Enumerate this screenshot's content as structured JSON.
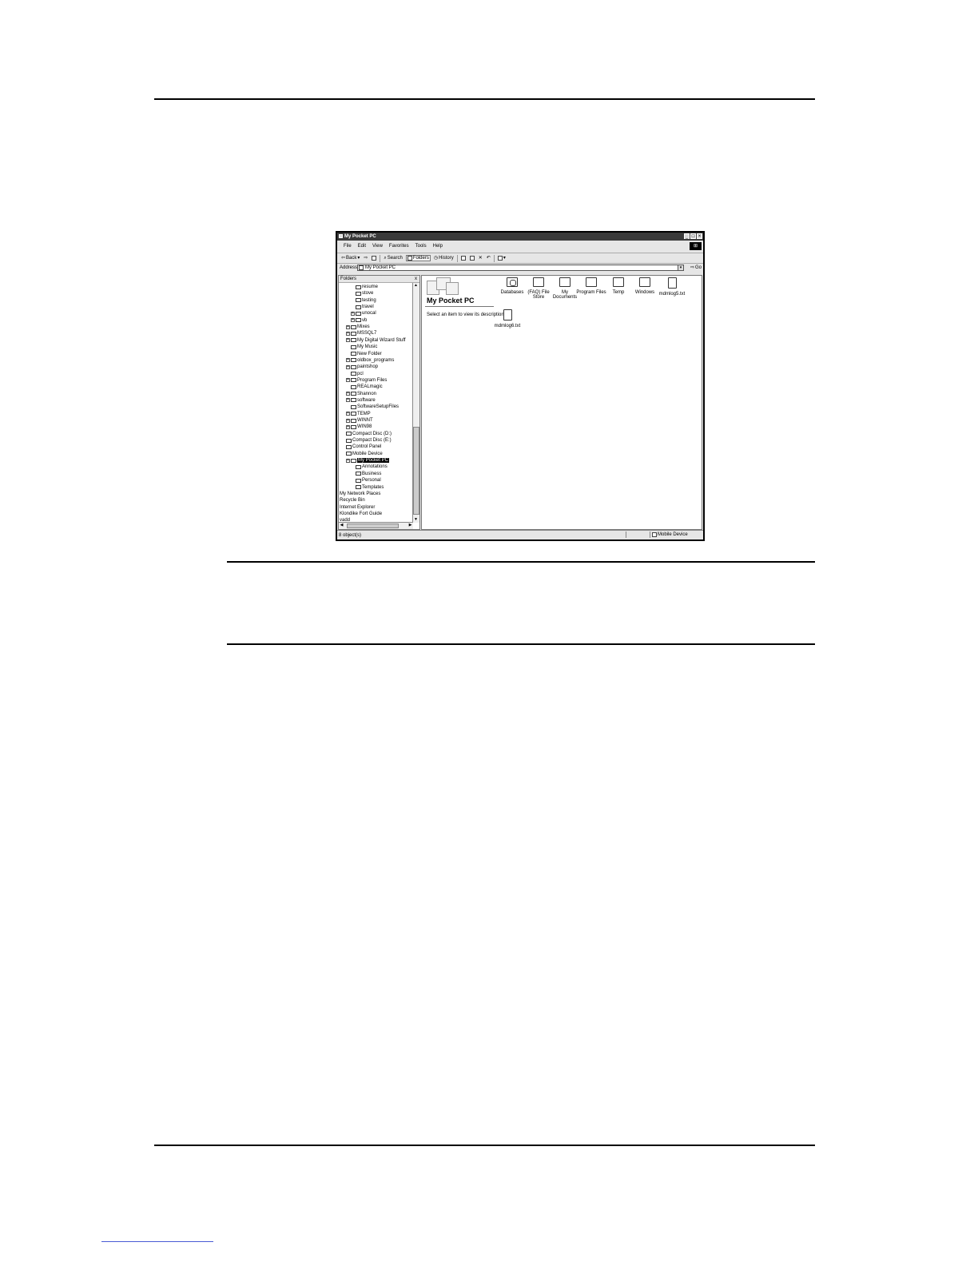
{
  "window": {
    "title": "My Pocket PC",
    "menu": [
      "File",
      "Edit",
      "View",
      "Favorites",
      "Tools",
      "Help"
    ],
    "toolbar": {
      "back": "Back",
      "search": "Search",
      "folders": "Folders",
      "history": "History"
    },
    "address": {
      "label": "Address",
      "value": "My Pocket PC",
      "go": "Go"
    },
    "folders_pane": {
      "title": "Folders",
      "close": "x",
      "tree": [
        {
          "label": "resume",
          "indent": 2,
          "expander": ""
        },
        {
          "label": "stove",
          "indent": 2,
          "expander": ""
        },
        {
          "label": "testing",
          "indent": 2,
          "expander": ""
        },
        {
          "label": "travel",
          "indent": 2,
          "expander": ""
        },
        {
          "label": "unocal",
          "indent": 2,
          "expander": "+"
        },
        {
          "label": "vb",
          "indent": 2,
          "expander": "+"
        },
        {
          "label": "Mixes",
          "indent": 1,
          "expander": "+"
        },
        {
          "label": "MSSQL7",
          "indent": 1,
          "expander": "+"
        },
        {
          "label": "My Digital Wizard Stuff",
          "indent": 1,
          "expander": "+"
        },
        {
          "label": "My Music",
          "indent": 1,
          "expander": ""
        },
        {
          "label": "New Folder",
          "indent": 1,
          "expander": ""
        },
        {
          "label": "oldbox_programs",
          "indent": 1,
          "expander": "+"
        },
        {
          "label": "paintshop",
          "indent": 1,
          "expander": "+"
        },
        {
          "label": "pcl",
          "indent": 1,
          "expander": ""
        },
        {
          "label": "Program Files",
          "indent": 1,
          "expander": "+"
        },
        {
          "label": "REALmagic",
          "indent": 1,
          "expander": ""
        },
        {
          "label": "Shannon",
          "indent": 1,
          "expander": "+"
        },
        {
          "label": "software",
          "indent": 1,
          "expander": "+"
        },
        {
          "label": "SoftwareSetupFiles",
          "indent": 1,
          "expander": ""
        },
        {
          "label": "TEMP",
          "indent": 1,
          "expander": "+"
        },
        {
          "label": "WINNT",
          "indent": 1,
          "expander": "+"
        },
        {
          "label": "WIN98",
          "indent": 1,
          "expander": "+"
        },
        {
          "label": "Compact Disc (D:)",
          "indent": 0,
          "expander": ""
        },
        {
          "label": "Compact Disc (E:)",
          "indent": 0,
          "expander": ""
        },
        {
          "label": "Control Panel",
          "indent": 0,
          "expander": ""
        },
        {
          "label": "Mobile Device",
          "indent": 0,
          "expander": ""
        },
        {
          "label": "My Pocket PC",
          "indent": 1,
          "expander": "+",
          "selected": true
        },
        {
          "label": "Annotations",
          "indent": 2,
          "expander": ""
        },
        {
          "label": "Business",
          "indent": 2,
          "expander": ""
        },
        {
          "label": "Personal",
          "indent": 2,
          "expander": ""
        },
        {
          "label": "Templates",
          "indent": 2,
          "expander": ""
        },
        {
          "label": "My Network Places",
          "indent": -1,
          "expander": ""
        },
        {
          "label": "Recycle Bin",
          "indent": -1,
          "expander": ""
        },
        {
          "label": "Internet Explorer",
          "indent": -1,
          "expander": ""
        },
        {
          "label": "Klondike Fort Guide",
          "indent": -1,
          "expander": ""
        },
        {
          "label": "vadd",
          "indent": -1,
          "expander": ""
        }
      ]
    },
    "content": {
      "heading": "My Pocket PC",
      "description": "Select an item to view its description.",
      "items": [
        {
          "label": "Databases",
          "icon": "database-icon"
        },
        {
          "label": "(FAQ) File Store",
          "icon": "folder-icon"
        },
        {
          "label": "My Documents",
          "icon": "folder-icon"
        },
        {
          "label": "Program Files",
          "icon": "folder-icon"
        },
        {
          "label": "Temp",
          "icon": "folder-icon"
        },
        {
          "label": "Windows",
          "icon": "folder-icon"
        },
        {
          "label": "mdmlog5.txt",
          "icon": "text-file-icon"
        },
        {
          "label": "mdmlog6.txt",
          "icon": "text-file-icon"
        }
      ]
    },
    "status": {
      "left": "8 object(s)",
      "right": "Mobile Device"
    }
  }
}
